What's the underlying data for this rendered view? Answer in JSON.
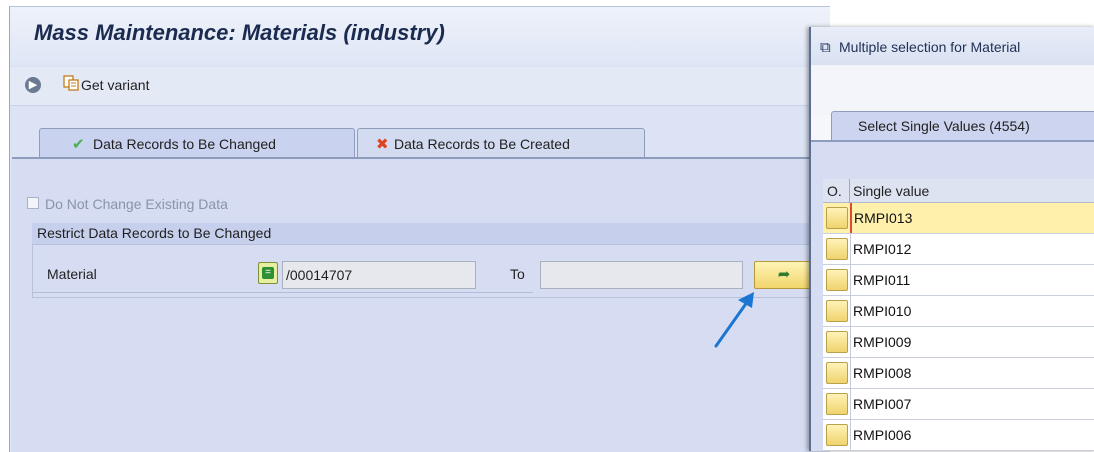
{
  "main": {
    "title": "Mass Maintenance: Materials (industry)",
    "toolbar": {
      "execute_icon": "execute-icon",
      "get_variant_label": "Get variant"
    },
    "tabs": [
      {
        "label": "Data Records to Be Changed",
        "icon": "checkmark-icon",
        "icon_color": "#4caf50"
      },
      {
        "label": "Data Records to Be Created",
        "icon": "x-icon",
        "icon_color": "#e0431f"
      }
    ],
    "do_not_change_label": "Do Not Change Existing Data",
    "restrict_group_title": "Restrict Data Records to Be Changed",
    "material_label": "Material",
    "material_from_value": "/00014707",
    "to_label": "To",
    "material_to_value": ""
  },
  "popup": {
    "title": "Multiple selection for Material",
    "tab_label": "Select Single Values (4554)",
    "columns": {
      "o": "O.",
      "value": "Single value"
    },
    "rows": [
      "RMPI013",
      "RMPI012",
      "RMPI011",
      "RMPI010",
      "RMPI009",
      "RMPI008",
      "RMPI007",
      "RMPI006"
    ]
  },
  "colors": {
    "accent_arrow": "#1a76d2",
    "highlight_row": "#fff1ab"
  }
}
